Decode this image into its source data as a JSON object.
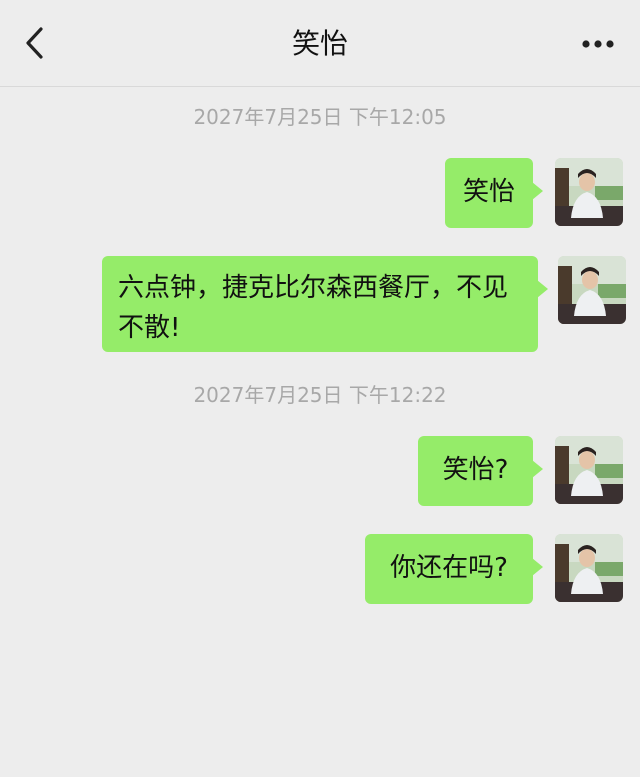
{
  "header": {
    "title": "笑怡",
    "back_icon": "chevron-left-icon",
    "more_icon": "more-dots-icon"
  },
  "timestamps": [
    "2027年7月25日 下午12:05",
    "2027年7月25日 下午12:22"
  ],
  "messages": [
    {
      "text": "笑怡"
    },
    {
      "text": "六点钟，捷克比尔森西餐厅，不见不散!"
    },
    {
      "text": "笑怡?"
    },
    {
      "text": "你还在吗?"
    }
  ],
  "colors": {
    "background": "#ededed",
    "bubble": "#95ec69",
    "timestamp": "#a8a8a8"
  }
}
